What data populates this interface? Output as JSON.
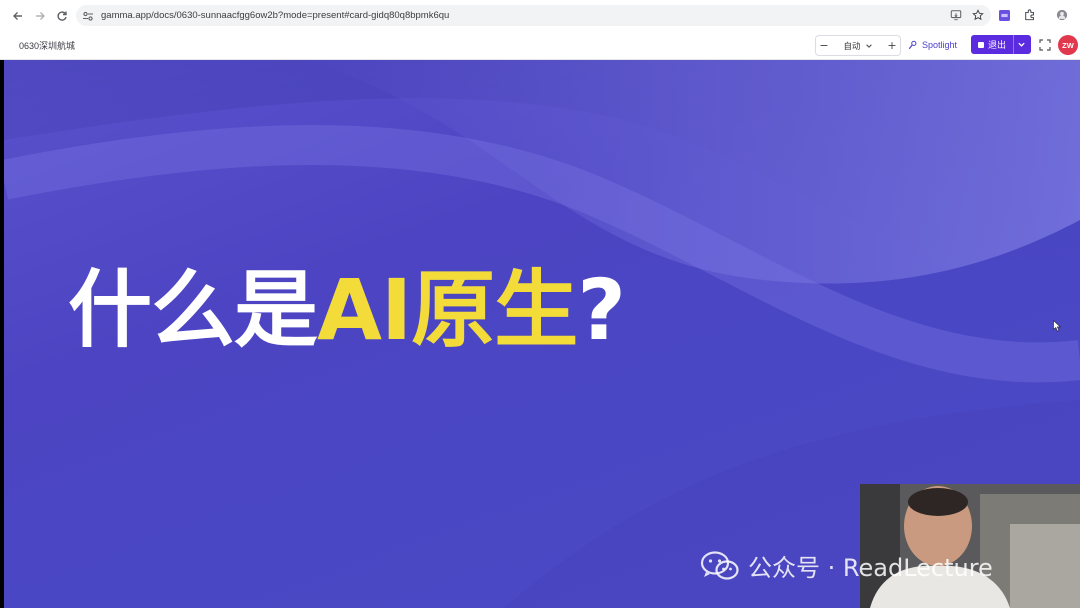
{
  "browser": {
    "url": "gamma.app/docs/0630-sunnaacfgg6ow2b?mode=present#card-gidq80q8bpmk6qu"
  },
  "toolbar": {
    "doc_title": "0630深圳航城",
    "zoom_value": "自动",
    "zoom_minus": "−",
    "zoom_plus": "+",
    "spotlight_label": "Spotlight",
    "exit_label": "退出",
    "avatar_initials": "ZW",
    "accent_color": "#5b2be0",
    "avatar_color": "#e2384d"
  },
  "slide": {
    "heading_part1": "什么是",
    "heading_part2": "AI原生",
    "heading_part3": "?",
    "background_color": "#4c44c2",
    "highlight_color": "#f3dc3a"
  },
  "watermark": {
    "text": "公众号 · ReadLecture"
  }
}
